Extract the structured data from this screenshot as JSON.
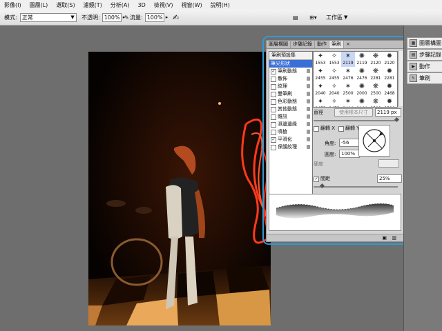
{
  "menu": [
    "影像(I)",
    "圖層(L)",
    "選取(S)",
    "濾鏡(T)",
    "分析(A)",
    "3D",
    "檢視(V)",
    "視窗(W)",
    "說明(H)"
  ],
  "options": {
    "mode_label": "模式:",
    "mode_value": "正常",
    "opacity_label": "不透明:",
    "opacity_value": "100%",
    "flow_label": "流量:",
    "flow_value": "100%",
    "workspace_label": "工作區"
  },
  "brush_panel": {
    "tabs": [
      "圖層構圖",
      "步驟記錄",
      "動作",
      "筆刷"
    ],
    "presets_header": "筆刷預設集",
    "presets": [
      {
        "label": "筆尖形狀",
        "checked": false,
        "selected": true
      },
      {
        "label": "筆刷動態",
        "checked": true
      },
      {
        "label": "散佈",
        "checked": false
      },
      {
        "label": "紋理",
        "checked": false
      },
      {
        "label": "雙筆刷",
        "checked": false
      },
      {
        "label": "色彩動態",
        "checked": false
      },
      {
        "label": "其他動態",
        "checked": false
      },
      {
        "label": "雜訊",
        "checked": false
      },
      {
        "label": "濕邊邊緣",
        "checked": false
      },
      {
        "label": "噴槍",
        "checked": false
      },
      {
        "label": "平滑化",
        "checked": true
      },
      {
        "label": "保護紋理",
        "checked": false
      }
    ],
    "tips": [
      [
        "1553",
        "1553",
        "2119",
        "2119",
        "2120",
        "2120"
      ],
      [
        "2455",
        "2455",
        "2476",
        "2476",
        "2281",
        "2281"
      ],
      [
        "2040",
        "2040",
        "2500",
        "2000",
        "2500",
        "2468"
      ],
      [
        "2473",
        "2473",
        "2444",
        "2444",
        "2500",
        "2500"
      ]
    ],
    "diameter_label": "直徑",
    "use_sample_label": "使用樣本尺寸",
    "diameter_value": "2119 px",
    "flip_x_label": "翻轉 X",
    "flip_y_label": "翻轉 Y",
    "angle_label": "角度:",
    "angle_value": "-56",
    "roundness_label": "圓度:",
    "roundness_value": "100%",
    "hardness_label": "硬度",
    "spacing_label": "間距",
    "spacing_value": "25%",
    "spacing_checked": "✓"
  },
  "dock": [
    "圖層構圖",
    "步驟記錄",
    "動作",
    "筆刷"
  ],
  "colors": {
    "highlight": "#2f9bd6",
    "selection": "#3b6fd8",
    "light_trail": "#ff3a1a"
  }
}
